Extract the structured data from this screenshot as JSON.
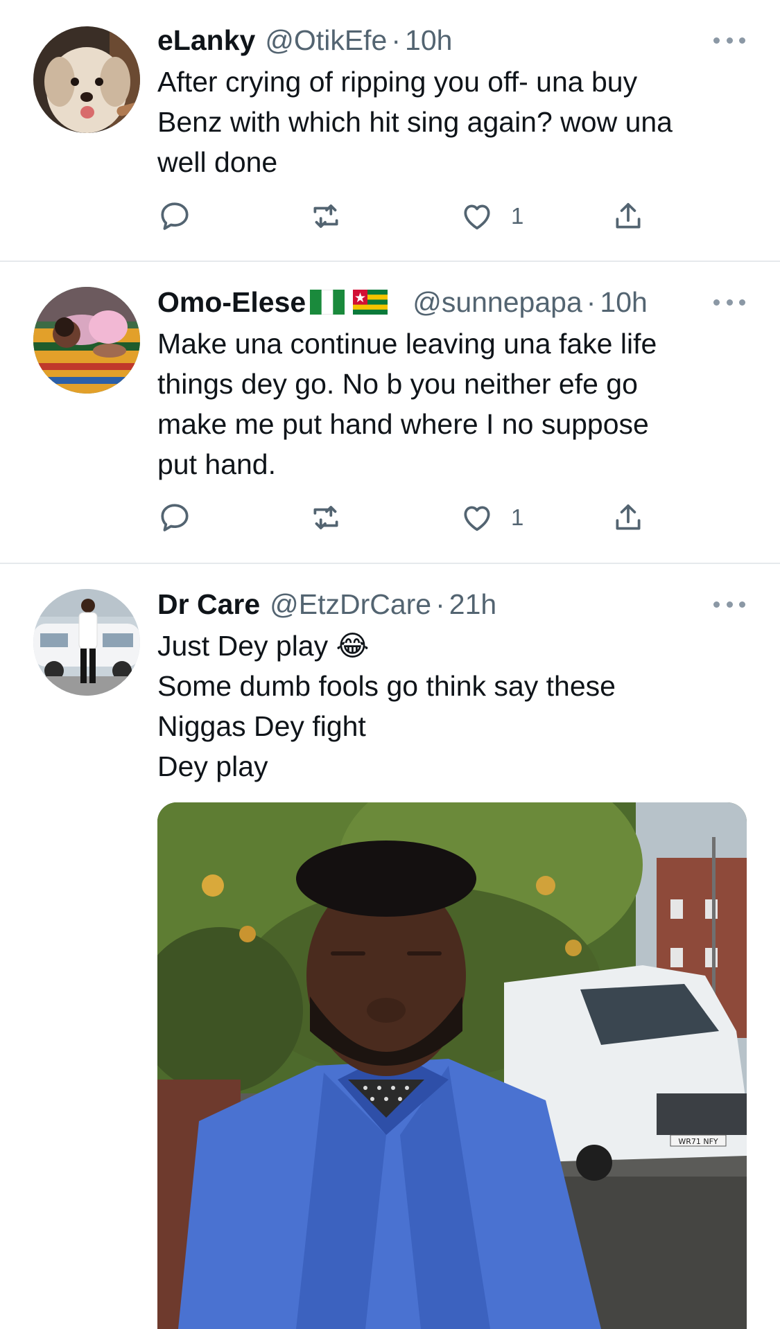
{
  "tweets": [
    {
      "name": "eLanky",
      "handle": "@OtikEfe",
      "separator": "·",
      "time": "10h",
      "lines": [
        "After crying of ripping you off- una buy",
        "Benz with which hit sing again? wow una",
        "well done"
      ],
      "replies": "",
      "retweets": "",
      "likes": "1",
      "avatar_icon": "dog-photo"
    },
    {
      "name": "Omo-Elese",
      "flags": [
        "nigeria-flag-icon",
        "togo-flag-icon"
      ],
      "handle": "@sunnepapa",
      "separator": "·",
      "time": "10h",
      "lines": [
        "Make una continue leaving una fake life",
        "things dey go.  No b you neither efe go",
        "make me put hand where I no suppose",
        "put hand."
      ],
      "replies": "",
      "retweets": "",
      "likes": "1",
      "avatar_icon": "sleeping-baby-photo"
    },
    {
      "name": "Dr Care",
      "handle": "@EtzDrCare",
      "separator": "·",
      "time": "21h",
      "lines": [
        "Just Dey play 😂",
        "Some dumb fools go think say these",
        "Niggas Dey fight",
        "Dey play"
      ],
      "avatar_icon": "man-with-car-photo",
      "media": {
        "description_icon": "video-thumbnail-man-in-blue-suit",
        "plate_text": "WR71 NFY"
      }
    }
  ],
  "colors": {
    "text": "#0f1419",
    "secondary": "#536471",
    "icon": "#536471",
    "divider": "#e6e9ec"
  }
}
